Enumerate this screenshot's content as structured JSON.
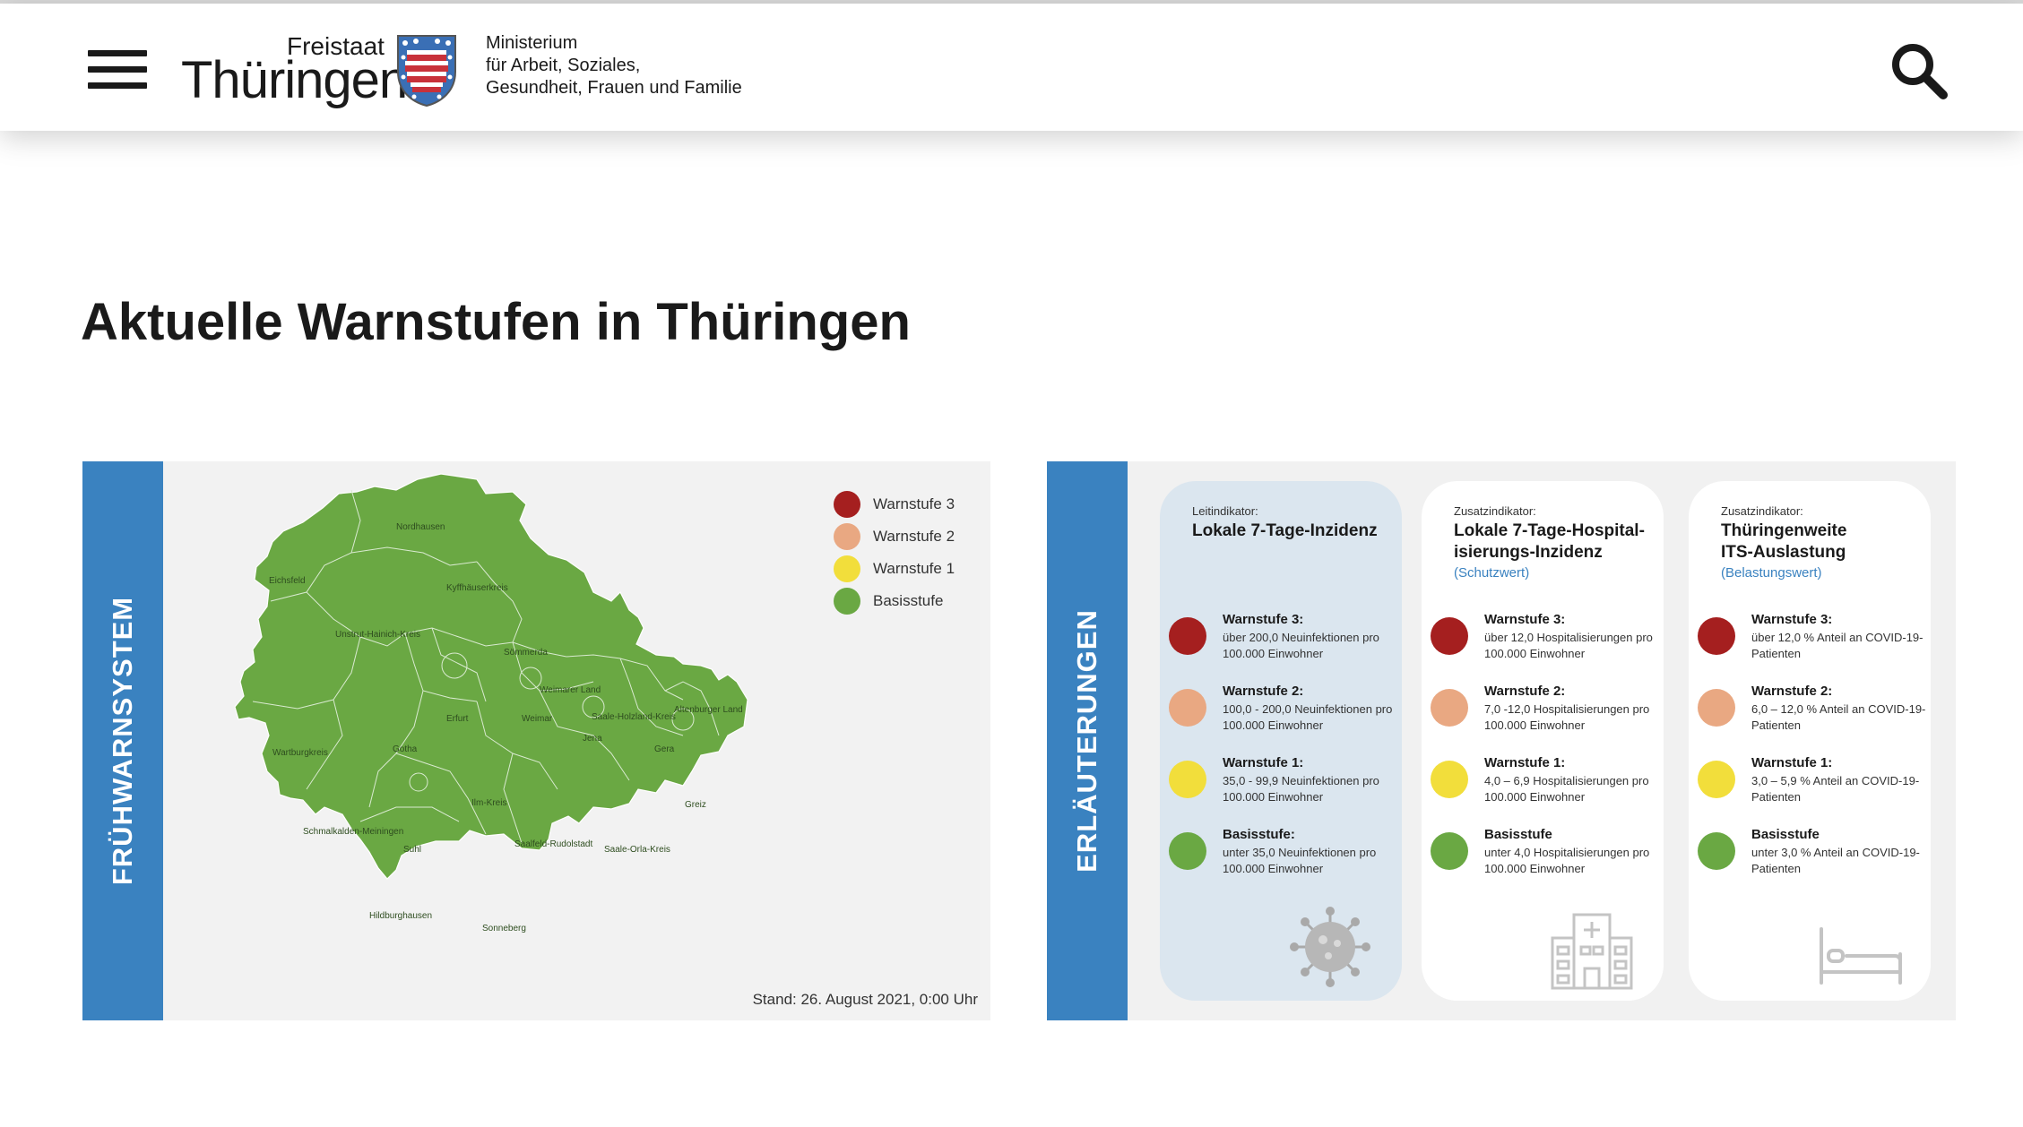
{
  "header": {
    "logo_top": "Freistaat",
    "logo_main": "Thüringen",
    "ministry_lines": [
      "Ministerium",
      "für Arbeit, Soziales,",
      "Gesundheit, Frauen und Familie"
    ]
  },
  "page": {
    "title": "Aktuelle Warnstufen in Thüringen"
  },
  "colors": {
    "accent_blue": "#3a82c0",
    "warnstufe_3": "#a51f1f",
    "warnstufe_2": "#e9a882",
    "warnstufe_1": "#f2de3b",
    "basisstufe": "#6aa843",
    "map_green": "#6aa843"
  },
  "map_card": {
    "band_label": "FRÜHWARNSYSTEM",
    "legend": [
      {
        "label": "Warnstufe 3",
        "color": "#a51f1f"
      },
      {
        "label": "Warnstufe 2",
        "color": "#e9a882"
      },
      {
        "label": "Warnstufe 1",
        "color": "#f2de3b"
      },
      {
        "label": "Basisstufe",
        "color": "#6aa843"
      }
    ],
    "districts": [
      "Nordhausen",
      "Eichsfeld",
      "Kyffhäuserkreis",
      "Unstrut-Hainich-Kreis",
      "Sömmerda",
      "Weimarer Land",
      "Erfurt",
      "Weimar",
      "Saale-Holzland-Kreis",
      "Jena",
      "Altenburger Land",
      "Gera",
      "Wartburgkreis",
      "Gotha",
      "Ilm-Kreis",
      "Greiz",
      "Schmalkalden-Meiningen",
      "Suhl",
      "Saalfeld-Rudolstadt",
      "Saale-Orla-Kreis",
      "Hildburghausen",
      "Sonneberg"
    ],
    "stand": "Stand: 26. August 2021, 0:00 Uhr"
  },
  "explain_card": {
    "band_label": "ERLÄUTERUNGEN",
    "columns": [
      {
        "kicker": "Leitindikator:",
        "title_lines": [
          "Lokale 7-Tage-Inzidenz"
        ],
        "subtitle": "",
        "icon": "virus-icon",
        "levels": [
          {
            "name": "Warnstufe 3:",
            "desc": "über 200,0 Neuinfektionen pro 100.000 Einwohner",
            "color": "#a51f1f"
          },
          {
            "name": "Warnstufe 2:",
            "desc": "100,0 - 200,0 Neuinfektionen pro 100.000 Einwohner",
            "color": "#e9a882"
          },
          {
            "name": "Warnstufe 1:",
            "desc": "35,0 - 99,9 Neuinfektionen pro 100.000 Einwohner",
            "color": "#f2de3b"
          },
          {
            "name": "Basisstufe:",
            "desc": "unter 35,0 Neuinfektionen pro 100.000 Einwohner",
            "color": "#6aa843"
          }
        ]
      },
      {
        "kicker": "Zusatzindikator:",
        "title_lines": [
          "Lokale 7-Tage-Hospital-",
          "isierungs-Inzidenz"
        ],
        "subtitle": "(Schutzwert)",
        "icon": "hospital-icon",
        "levels": [
          {
            "name": "Warnstufe 3:",
            "desc": "über 12,0 Hospitalisierungen pro 100.000 Einwohner",
            "color": "#a51f1f"
          },
          {
            "name": "Warnstufe 2:",
            "desc": "7,0 -12,0 Hospitalisierungen pro 100.000 Einwohner",
            "color": "#e9a882"
          },
          {
            "name": "Warnstufe 1:",
            "desc": "4,0 – 6,9 Hospitalisierungen pro 100.000 Einwohner",
            "color": "#f2de3b"
          },
          {
            "name": "Basisstufe",
            "desc": "unter 4,0 Hospitalisierungen pro 100.000 Einwohner",
            "color": "#6aa843"
          }
        ]
      },
      {
        "kicker": "Zusatzindikator:",
        "title_lines": [
          "Thüringenweite",
          "ITS-Auslastung"
        ],
        "subtitle": "(Belastungswert)",
        "icon": "bed-icon",
        "levels": [
          {
            "name": "Warnstufe 3:",
            "desc": "über 12,0 % Anteil an COVID-19-Patienten",
            "color": "#a51f1f"
          },
          {
            "name": "Warnstufe 2:",
            "desc": "6,0 – 12,0 % Anteil an COVID-19-Patienten",
            "color": "#e9a882"
          },
          {
            "name": "Warnstufe 1:",
            "desc": "3,0 – 5,9 % Anteil an COVID-19-Patienten",
            "color": "#f2de3b"
          },
          {
            "name": "Basisstufe",
            "desc": "unter 3,0 % Anteil an COVID-19-Patienten",
            "color": "#6aa843"
          }
        ]
      }
    ]
  }
}
